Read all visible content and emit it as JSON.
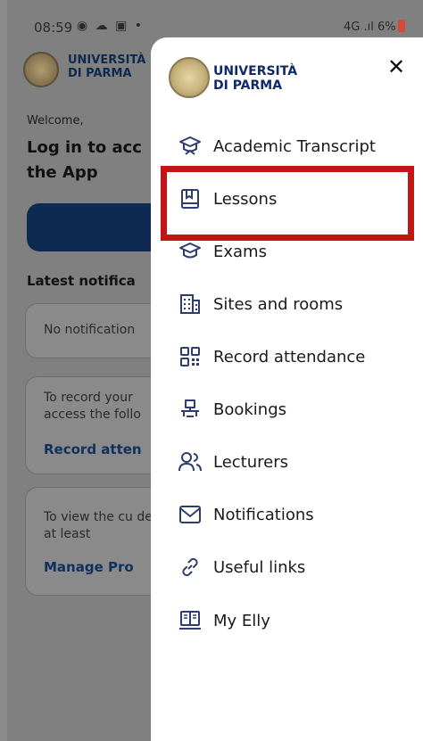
{
  "status": {
    "time": "08:59",
    "icons_left": "◉ ☁ ▣ •",
    "right_text": "4G .ıl 6%"
  },
  "background": {
    "logo_line1": "UNIVERSITÀ",
    "logo_line2": "DI PARMA",
    "welcome": "Welcome,",
    "login": "Log in to acc the App",
    "latest": "Latest notifica",
    "card1": "No notification",
    "card2_text": "To record your access the follo",
    "card2_link": "Record atten",
    "card3_text": "To view the cu define at least",
    "card3_link": "Manage Pro"
  },
  "drawer": {
    "logo_line1": "UNIVERSITÀ",
    "logo_line2": "DI PARMA",
    "close_icon": "✕",
    "items": [
      {
        "label": "Academic Transcript",
        "icon": "graduation-cap-icon"
      },
      {
        "label": "Lessons",
        "icon": "book-icon"
      },
      {
        "label": "Exams",
        "icon": "exam-cap-icon"
      },
      {
        "label": "Sites and rooms",
        "icon": "building-icon"
      },
      {
        "label": "Record attendance",
        "icon": "qr-code-icon"
      },
      {
        "label": "Bookings",
        "icon": "desk-icon"
      },
      {
        "label": "Lecturers",
        "icon": "people-icon"
      },
      {
        "label": "Notifications",
        "icon": "envelope-icon"
      },
      {
        "label": "Useful links",
        "icon": "link-icon"
      },
      {
        "label": "My Elly",
        "icon": "laptop-book-icon"
      }
    ]
  },
  "colors": {
    "brand_navy": "#0f2a6b",
    "highlight": "#c41515"
  }
}
